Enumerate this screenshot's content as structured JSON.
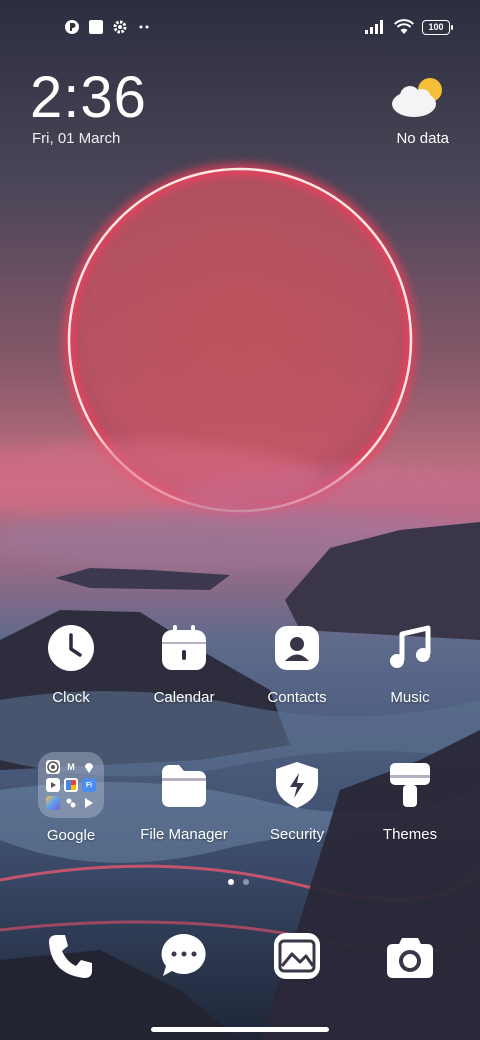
{
  "status_bar": {
    "left_icons": [
      "app-notification-icon",
      "square-notification-icon",
      "settings-notification-icon",
      "more-notifications-icon"
    ],
    "battery": "100"
  },
  "clock_widget": {
    "time": "2:36",
    "date": "Fri, 01 March"
  },
  "weather_widget": {
    "icon": "partly-cloudy-icon",
    "text": "No data"
  },
  "apps_row1": [
    {
      "label": "Clock",
      "icon": "clock-icon"
    },
    {
      "label": "Calendar",
      "icon": "calendar-icon"
    },
    {
      "label": "Contacts",
      "icon": "contacts-icon"
    },
    {
      "label": "Music",
      "icon": "music-note-icon"
    }
  ],
  "apps_row2": [
    {
      "label": "Google",
      "icon": "google-folder"
    },
    {
      "label": "File Manager",
      "icon": "folder-icon"
    },
    {
      "label": "Security",
      "icon": "shield-bolt-icon"
    },
    {
      "label": "Themes",
      "icon": "paint-roller-icon"
    }
  ],
  "google_folder_apps": [
    "chrome-icon",
    "gmail-icon",
    "maps-icon",
    "youtube-icon",
    "google-icon",
    "meet-icon",
    "photos-icon",
    "assistant-icon",
    "play-icon"
  ],
  "dock": [
    {
      "icon": "phone-icon"
    },
    {
      "icon": "messages-icon"
    },
    {
      "icon": "gallery-icon"
    },
    {
      "icon": "camera-icon"
    }
  ],
  "page_indicator": {
    "pages": 2,
    "current": 1
  }
}
